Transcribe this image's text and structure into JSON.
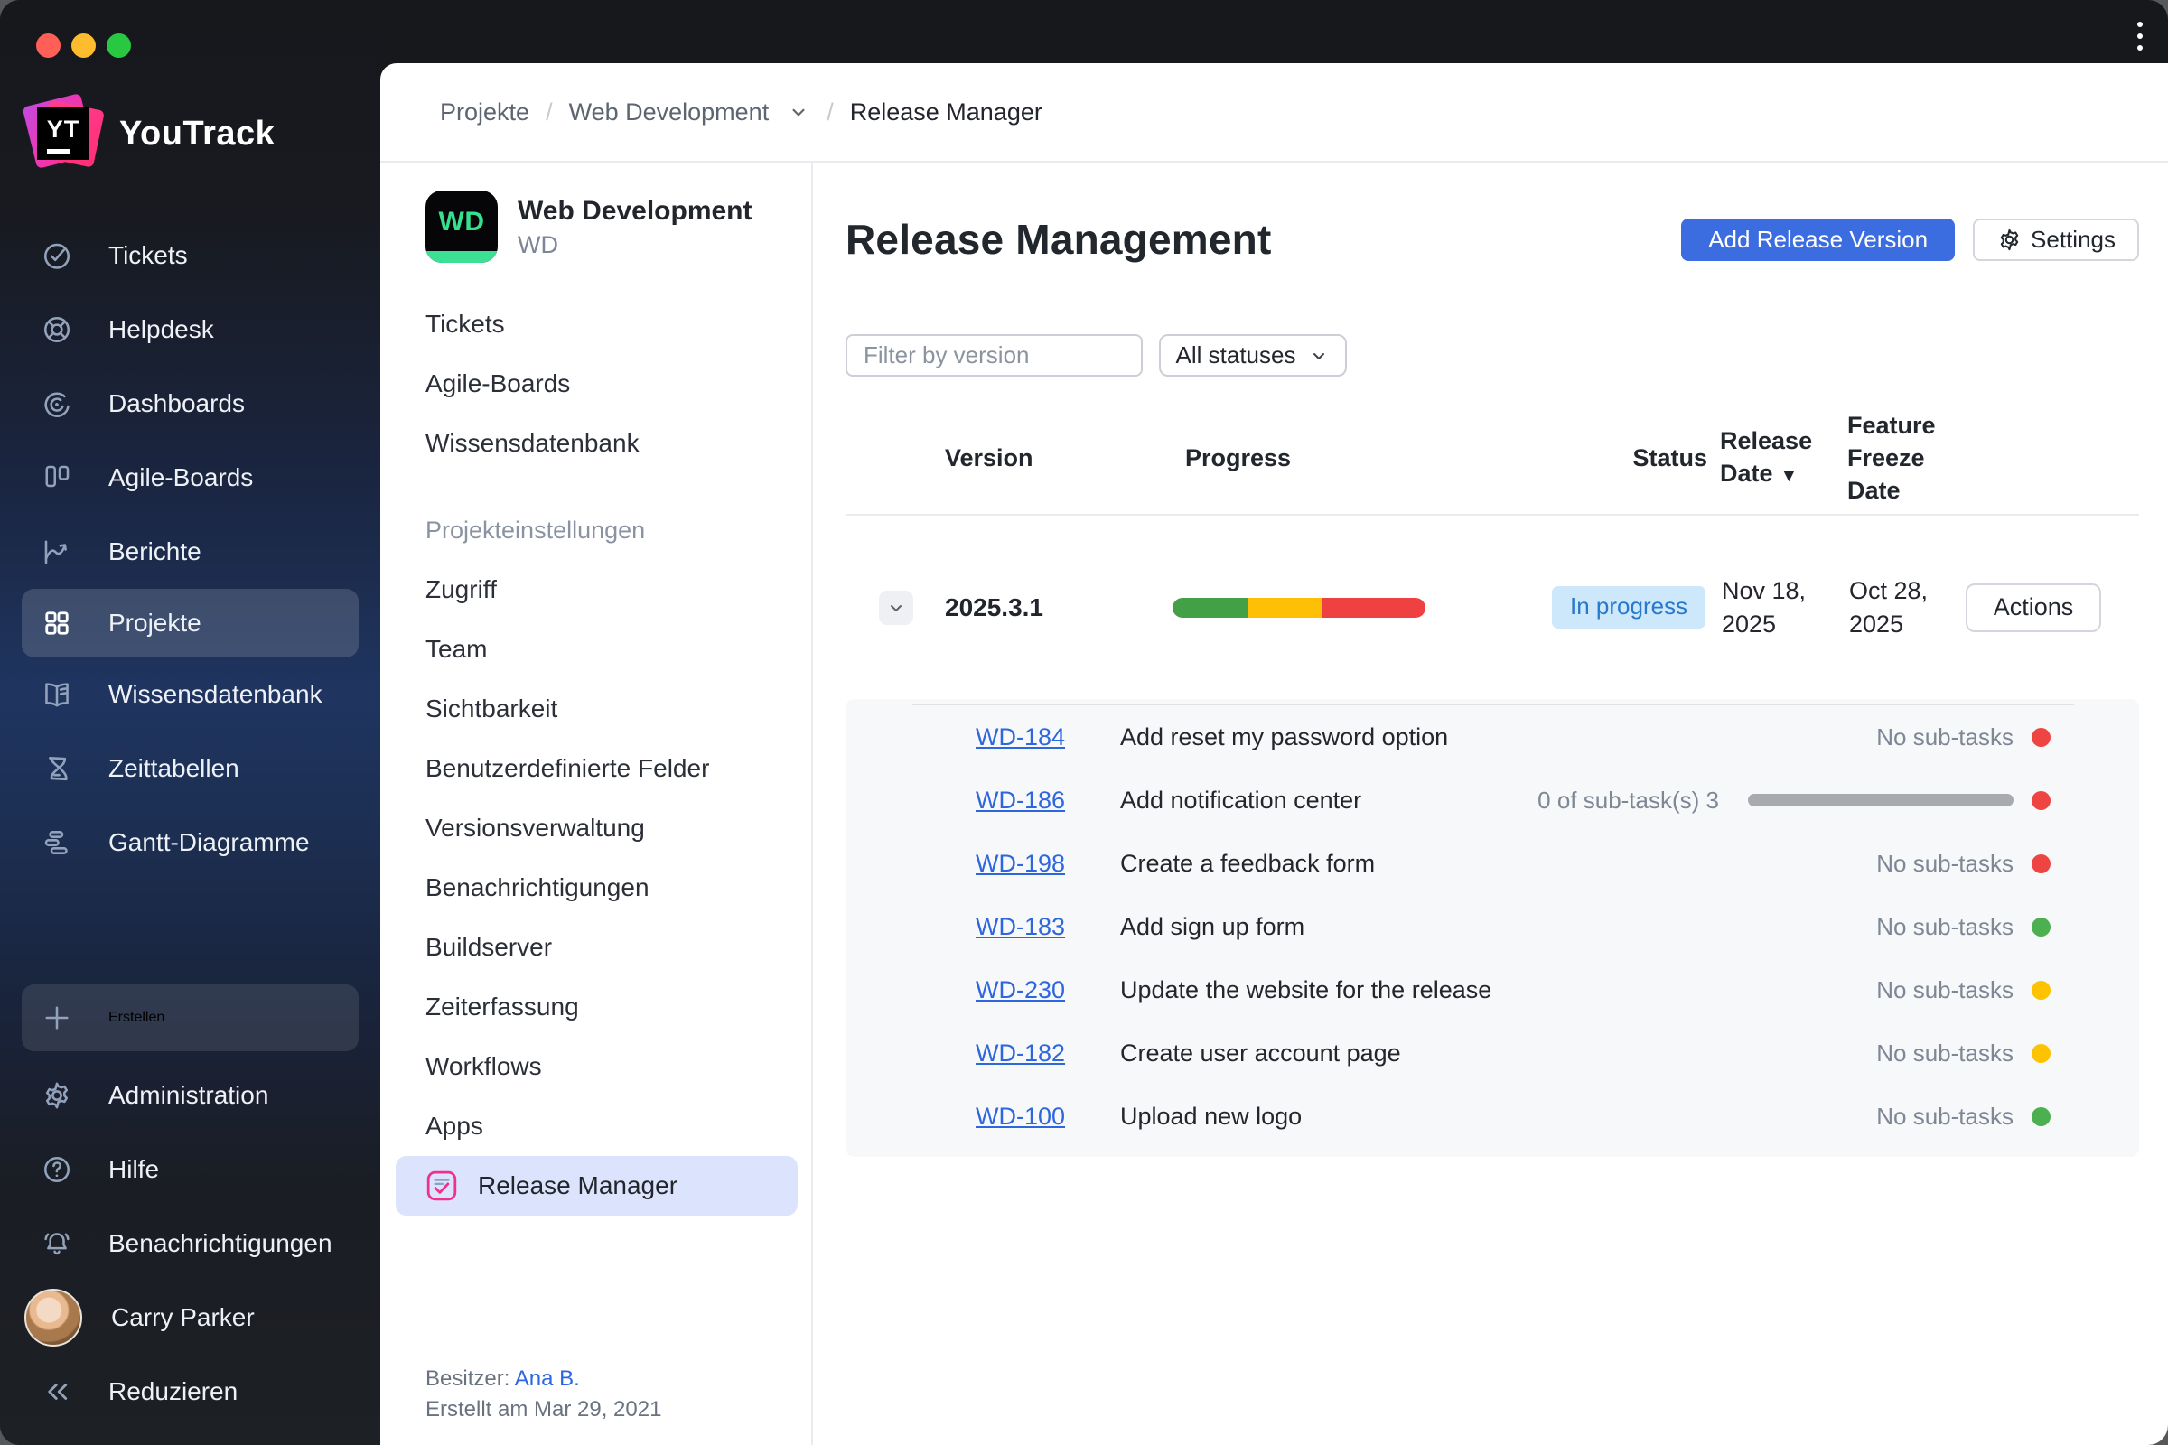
{
  "titlebar": {
    "traffic_colors": {
      "close": "#ff5f57",
      "minimize": "#febc2e",
      "zoom": "#28c840"
    }
  },
  "brand": {
    "name": "YouTrack",
    "logo_monogram": "YT"
  },
  "sidebar": {
    "items": [
      {
        "label": "Tickets"
      },
      {
        "label": "Helpdesk"
      },
      {
        "label": "Dashboards"
      },
      {
        "label": "Agile-Boards"
      },
      {
        "label": "Berichte"
      },
      {
        "label": "Projekte"
      },
      {
        "label": "Wissensdatenbank"
      },
      {
        "label": "Zeittabellen"
      },
      {
        "label": "Gantt-Diagramme"
      }
    ],
    "create_label": "Erstellen",
    "admin_label": "Administration",
    "help_label": "Hilfe",
    "notifications_label": "Benachrichtigungen",
    "user_name": "Carry Parker",
    "collapse_label": "Reduzieren"
  },
  "breadcrumb": {
    "level1": "Projekte",
    "level2": "Web Development",
    "level3": "Release Manager",
    "separator": "/"
  },
  "project_panel": {
    "avatar_text": "WD",
    "title": "Web Development",
    "subtitle": "WD",
    "nav_items": [
      "Tickets",
      "Agile-Boards",
      "Wissensdatenbank"
    ],
    "settings_heading": "Projekteinstellungen",
    "settings_items": [
      "Zugriff",
      "Team",
      "Sichtbarkeit",
      "Benutzerdefinierte Felder",
      "Versionsverwaltung",
      "Benachrichtigungen",
      "Buildserver",
      "Zeiterfassung",
      "Workflows",
      "Apps"
    ],
    "active_item": "Release Manager",
    "owner_label": "Besitzer:",
    "owner_name": "Ana B.",
    "created_text": "Erstellt am Mar 29, 2021"
  },
  "main": {
    "title": "Release Management",
    "add_button_label": "Add Release Version",
    "settings_button_label": "Settings",
    "filter_placeholder": "Filter by version",
    "status_filter_value": "All statuses",
    "table_headers": {
      "version": "Version",
      "progress": "Progress",
      "status": "Status",
      "release_date": "Release Date",
      "sort_arrow": "▼",
      "freeze_date": "Feature Freeze Date"
    },
    "release_row": {
      "version": "2025.3.1",
      "status": "In progress",
      "status_bg": "#cde8fb",
      "status_text_color": "#2878cc",
      "release_date": "Nov 18, 2025",
      "freeze_date": "Oct 28, 2025",
      "actions_label": "Actions",
      "progress_segments": [
        {
          "color": "#43a047",
          "width": "30%"
        },
        {
          "color": "#fdc007",
          "width": "29%"
        },
        {
          "color": "#ef4141",
          "width": "41%"
        }
      ]
    },
    "subtask_rows": [
      {
        "id": "WD-184",
        "title": "Add reset my password option",
        "subtask_text": "No sub-tasks",
        "dot_color": "#ee4543"
      },
      {
        "id": "WD-186",
        "title": "Add notification center",
        "subtask_text": "0 of sub-task(s) 3",
        "dot_color": "#ee4543"
      },
      {
        "id": "WD-198",
        "title": "Create a feedback form",
        "subtask_text": "No sub-tasks",
        "dot_color": "#ee4543"
      },
      {
        "id": "WD-183",
        "title": "Add sign up form",
        "subtask_text": "No sub-tasks",
        "dot_color": "#4caf50"
      },
      {
        "id": "WD-230",
        "title": "Update the website for the release",
        "subtask_text": "No sub-tasks",
        "dot_color": "#fdc300"
      },
      {
        "id": "WD-182",
        "title": "Create user account page",
        "subtask_text": "No sub-tasks",
        "dot_color": "#fdc300"
      },
      {
        "id": "WD-100",
        "title": "Upload new logo",
        "subtask_text": "No sub-tasks",
        "dot_color": "#4caf50"
      }
    ]
  }
}
